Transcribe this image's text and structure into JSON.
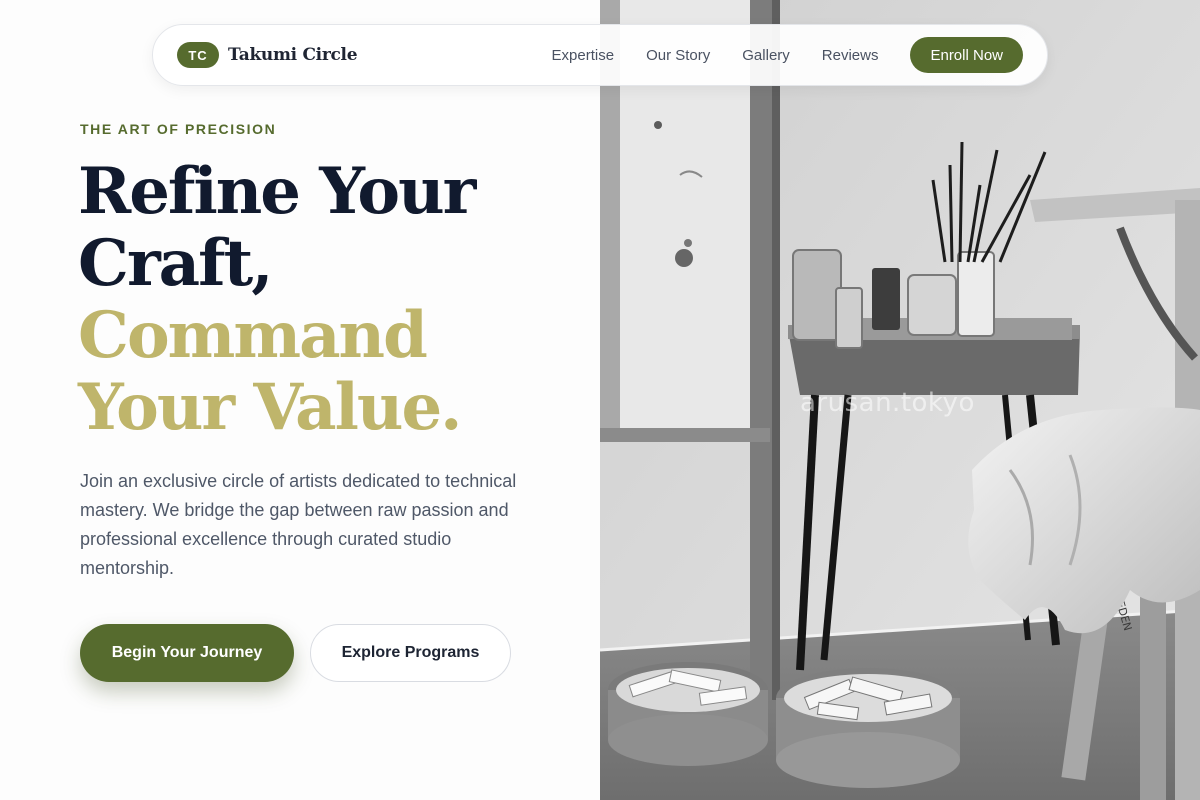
{
  "nav": {
    "brand_initials": "TC",
    "brand_name": "Takumi Circle",
    "links": [
      "Expertise",
      "Our Story",
      "Gallery",
      "Reviews"
    ],
    "cta": "Enroll Now"
  },
  "hero": {
    "eyebrow": "THE ART OF PRECISION",
    "headline_dark": [
      "Refine Your",
      "Craft,"
    ],
    "headline_accent": [
      "Command",
      "Your Value."
    ],
    "intro": "Join an exclusive circle of artists dedicated to technical mastery. We bridge the gap between raw passion and professional excellence through curated studio mentorship.",
    "primary_cta": "Begin Your Journey",
    "secondary_cta": "Explore Programs"
  },
  "photo": {
    "watermark": "arusan.tokyo",
    "stool_brand": "MEEDEN"
  },
  "colors": {
    "accent_green": "#566b2e",
    "accent_gold": "#bfb56b",
    "headline_navy": "#111a2e"
  }
}
